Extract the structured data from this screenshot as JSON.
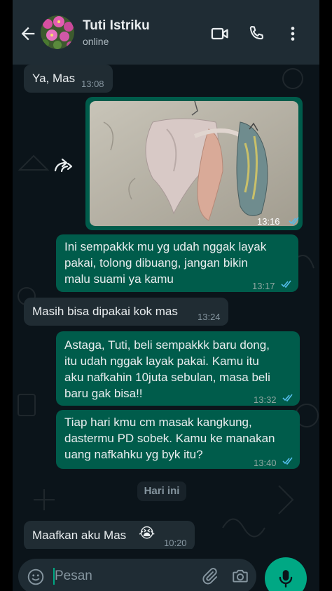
{
  "header": {
    "contact_name": "Tuti Istriku",
    "status": "online",
    "back_icon": "arrow-back-icon",
    "video_icon": "video-call-icon",
    "call_icon": "voice-call-icon",
    "menu_icon": "more-vertical-icon"
  },
  "messages": [
    {
      "direction": "incoming",
      "text": "Ya, Mas",
      "time": "13:08"
    },
    {
      "direction": "outgoing",
      "type": "image",
      "forwarded": true,
      "time": "13:16"
    },
    {
      "direction": "outgoing",
      "lines": [
        "Ini sempakkk mu yg udah nggak layak",
        "pakai, tolong dibuang, jangan bikin",
        "malu suami ya kamu"
      ],
      "time": "13:17"
    },
    {
      "direction": "incoming",
      "text": "Masih bisa dipakai kok mas",
      "time": "13:24"
    },
    {
      "direction": "outgoing",
      "lines": [
        "Astaga, Tuti, beli sempakkk baru dong,",
        "itu udah nggak layak pakai. Kamu itu",
        "aku nafkahin 10juta sebulan, masa beli",
        "baru gak bisa!!"
      ],
      "time": "13:32"
    },
    {
      "direction": "outgoing",
      "lines": [
        "Tiap hari kmu cm masak kangkung,",
        "dastermu PD sobek. Kamu ke manakan",
        "uang nafkahku yg byk itu?"
      ],
      "time": "13:40"
    },
    {
      "direction": "incoming",
      "text": "Maafkan aku Mas",
      "emoji": "😭",
      "time": "10:20"
    }
  ],
  "date_divider": "Hari ini",
  "composer": {
    "placeholder": "Pesan",
    "emoji_icon": "emoji-icon",
    "attach_icon": "paperclip-icon",
    "camera_icon": "camera-icon",
    "mic_icon": "microphone-icon"
  },
  "colors": {
    "header_bg": "#1f2c34",
    "chat_bg": "#0b141a",
    "incoming_bubble": "#202c33",
    "outgoing_bubble": "#005c4b",
    "accent": "#00a884",
    "read_ticks": "#53bdeb"
  }
}
